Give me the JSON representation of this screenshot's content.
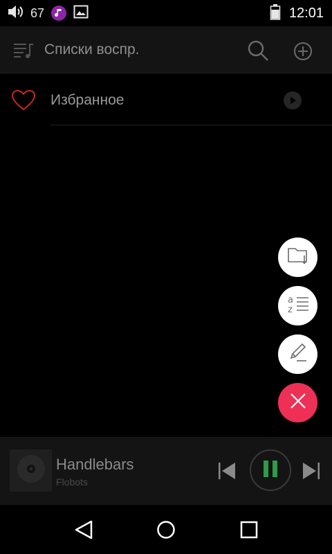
{
  "status_bar": {
    "volume_level": "67",
    "clock": "12:01",
    "icons": [
      "volume-icon",
      "music-notification-icon",
      "image-notification-icon",
      "battery-icon"
    ]
  },
  "toolbar": {
    "title": "Списки воспр.",
    "icons": [
      "playlist-menu-icon",
      "search-icon",
      "add-circle-icon"
    ]
  },
  "playlists": [
    {
      "name": "Избранное",
      "icon": "heart-icon",
      "action_icon": "play-icon"
    }
  ],
  "fab_menu": {
    "items": [
      "folder-import-icon",
      "sort-az-icon",
      "pencil-edit-icon",
      "close-icon"
    ],
    "close_color": "#ee3056"
  },
  "player": {
    "title": "Handlebars",
    "artist": "Flobots",
    "controls": [
      "previous-icon",
      "pause-icon",
      "next-icon"
    ],
    "accent": "#2e9c47"
  },
  "nav_bar": {
    "buttons": [
      "back-icon",
      "home-icon",
      "recent-apps-icon"
    ]
  },
  "colors": {
    "background": "#000000",
    "surface": "#141414",
    "heart": "#c62828"
  }
}
